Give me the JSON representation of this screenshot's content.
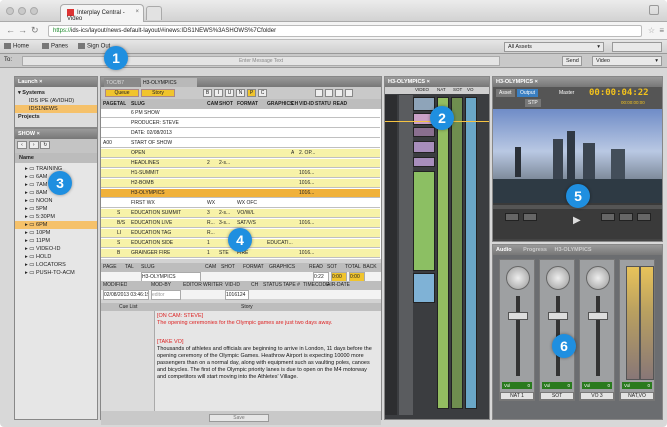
{
  "browser": {
    "tab_title": "Interplay Central - Video",
    "url_scheme": "https://",
    "url_rest": "ids-ics/layout/news-default-layout/#inews:IDS1NEWS%3ASHOWS%7Cfolder",
    "close": "×"
  },
  "toolbar": {
    "home": "Home",
    "panes": "Panes",
    "sign_out": "Sign Out",
    "assets_select": "All Assets"
  },
  "message_bar": {
    "to_label": "To:",
    "placeholder": "Enter Message Text",
    "send": "Send",
    "video_select": "Video"
  },
  "launch_pane": {
    "title": "Launch",
    "systems_label": "Systems",
    "system1": "IDS IPE (AVIDHD)",
    "system2": "IDS1NEWS",
    "projects_label": "Projects"
  },
  "show_pane": {
    "title": "SHOW",
    "name_header": "Name",
    "items": [
      "TRAINING",
      "6AM",
      "7AM",
      "8AM",
      "NOON",
      "5PM",
      "5:30PM",
      "6PM",
      "10PM",
      "11PM",
      "VIDEO-ID",
      "HOLD",
      "LOCATORS",
      "PUSH-TO-ACM"
    ],
    "selected_index": 7
  },
  "rundown": {
    "tab1": "TOC/B7",
    "tab2": "H3-OLYMPICS",
    "queue_btn": "Queue",
    "story_btn": "Story",
    "fmt_buttons": [
      "B",
      "I",
      "U",
      "N",
      "P",
      "C"
    ],
    "headers": [
      "PAGE",
      "TAL",
      "SLUG",
      "CAM",
      "SHOT",
      "FORMAT",
      "GRAPHICS",
      "CH",
      "VID-ID",
      "STATU",
      "READ"
    ],
    "rows": [
      {
        "page": "",
        "tal": "",
        "slug": "6 PM SHOW",
        "cam": "",
        "shot": "",
        "format": "",
        "gfx": "",
        "ch": "",
        "vid": "",
        "stat": "",
        "hl": "white"
      },
      {
        "page": "",
        "tal": "",
        "slug": "PRODUCER: STEVE",
        "cam": "",
        "shot": "",
        "format": "",
        "gfx": "",
        "ch": "",
        "vid": "",
        "stat": "",
        "hl": "white"
      },
      {
        "page": "",
        "tal": "",
        "slug": "DATE: 02/08/2013",
        "cam": "",
        "shot": "",
        "format": "",
        "gfx": "",
        "ch": "",
        "vid": "",
        "stat": "",
        "hl": "white"
      },
      {
        "page": "A00",
        "tal": "",
        "slug": "START OF SHOW",
        "cam": "",
        "shot": "",
        "format": "",
        "gfx": "",
        "ch": "",
        "vid": "",
        "stat": "",
        "hl": "white"
      },
      {
        "page": "",
        "tal": "",
        "slug": "OPEN",
        "cam": "",
        "shot": "",
        "format": "",
        "gfx": "",
        "ch": "A",
        "vid": "2. OP...",
        "stat": "",
        "hl": "yellow"
      },
      {
        "page": "",
        "tal": "",
        "slug": "HEADLINES",
        "cam": "2",
        "shot": "2-s...",
        "format": "",
        "gfx": "",
        "ch": "",
        "vid": "",
        "stat": "",
        "hl": "yellow"
      },
      {
        "page": "",
        "tal": "",
        "slug": "H1-SUMMIT",
        "cam": "",
        "shot": "",
        "format": "",
        "gfx": "",
        "ch": "",
        "vid": "1016...",
        "stat": "",
        "hl": "yellow"
      },
      {
        "page": "",
        "tal": "",
        "slug": "H2-BOMB",
        "cam": "",
        "shot": "",
        "format": "",
        "gfx": "",
        "ch": "",
        "vid": "1016...",
        "stat": "",
        "hl": "yellow"
      },
      {
        "page": "",
        "tal": "",
        "slug": "H3-OLYMPICS",
        "cam": "",
        "shot": "",
        "format": "",
        "gfx": "",
        "ch": "",
        "vid": "1016...",
        "stat": "",
        "hl": "orange"
      },
      {
        "page": "",
        "tal": "",
        "slug": "FIRST WX",
        "cam": "WX",
        "shot": "",
        "format": "WX OFC",
        "gfx": "",
        "ch": "",
        "vid": "",
        "stat": "",
        "hl": "white"
      },
      {
        "page": "",
        "tal": "S",
        "slug": "EDUCATION SUMMIT",
        "cam": "3",
        "shot": "2-s...",
        "format": "VO/W/L",
        "gfx": "",
        "ch": "",
        "vid": "",
        "stat": "",
        "hl": "yellow"
      },
      {
        "page": "",
        "tal": "B/S",
        "slug": "EDUCATION LIVE",
        "cam": "R...",
        "shot": "3-s...",
        "format": "SAT/V/S",
        "gfx": "",
        "ch": "",
        "vid": "1016...",
        "stat": "",
        "hl": "yellow"
      },
      {
        "page": "",
        "tal": "LI",
        "slug": "EDUCATION TAG",
        "cam": "R...",
        "shot": "",
        "format": "",
        "gfx": "",
        "ch": "",
        "vid": "",
        "stat": "",
        "hl": "yellow"
      },
      {
        "page": "",
        "tal": "S",
        "slug": "EDUCATION SIDE",
        "cam": "1",
        "shot": "",
        "format": "FULL",
        "gfx": "EDUCATI...",
        "ch": "",
        "vid": "",
        "stat": "",
        "hl": "yellow"
      },
      {
        "page": "",
        "tal": "B",
        "slug": "GRAINGER FIRE",
        "cam": "1",
        "shot": "STE",
        "format": "FIRE",
        "gfx": "",
        "ch": "",
        "vid": "1016...",
        "stat": "",
        "hl": "yellow"
      }
    ]
  },
  "story_form": {
    "headers": [
      "PAGE",
      "TAL",
      "SLUG",
      "CAM",
      "SHOT",
      "FORMAT",
      "GRAPHICS",
      "READ",
      "SOT",
      "TOTAL",
      "BACK"
    ],
    "slug_value": "H3-OLYMPICS",
    "read_value": "0:22",
    "sot_value": "0:00",
    "total_value": "0:00",
    "headers2": [
      "MODIFIED",
      "MOD-BY",
      "EDITOR",
      "WRITER",
      "VID-ID",
      "CH",
      "STATUS",
      "TAPE #",
      "TIMECODE",
      "AIR-DATE"
    ],
    "modified_value": "02/08/2013 03:46:19",
    "modby_value": "editor",
    "vid_value": "1016124"
  },
  "script": {
    "cue_header": "Cue List",
    "story_header": "Story",
    "block1_tag": "ON CAM: STEVE",
    "block1_text": "The opening ceremonies for the Olympic games are just two days away.",
    "block2_tag": "TAKE VO",
    "block2_text": "Thousands of athletes and officials are beginning to arrive in London, 11 days before the opening ceremony of the Olympic Games. Heathrow Airport is expecting 10000 more passengers than on a normal day, along with equipment such as vaulting poles, canoes and bicycles. The first of the Olympic priority lanes is due to open on the M4 motorway and competitors will start moving into the Athletes' Village.",
    "save_btn": "Save"
  },
  "timeline": {
    "tab": "H3-OLYMPICS",
    "cols": [
      "VIDEO",
      "NAT",
      "SOT",
      "VO"
    ]
  },
  "monitor": {
    "tab": "H3-OLYMPICS",
    "asset_btn": "Asset",
    "output_btn": "Output",
    "stp_btn": "STP",
    "master_label": "Master",
    "timecode": "00:00:04:22",
    "sub_timecode": "00:00:00:00"
  },
  "audio": {
    "tab": "Audio",
    "tab2": "Progress",
    "tab3": "H3-OLYMPICS",
    "vol_label": "Vol",
    "vol_value": "0",
    "channels": [
      "NAT 1",
      "SOT",
      "VO 3",
      "NAT,VO"
    ]
  },
  "callouts": [
    "1",
    "2",
    "3",
    "4",
    "5",
    "6"
  ],
  "colors": {
    "badge": "#1f8fe0",
    "yellow_row": "#f7f2a8",
    "orange_row": "#f0b13a",
    "timecode": "#f3c21c"
  }
}
